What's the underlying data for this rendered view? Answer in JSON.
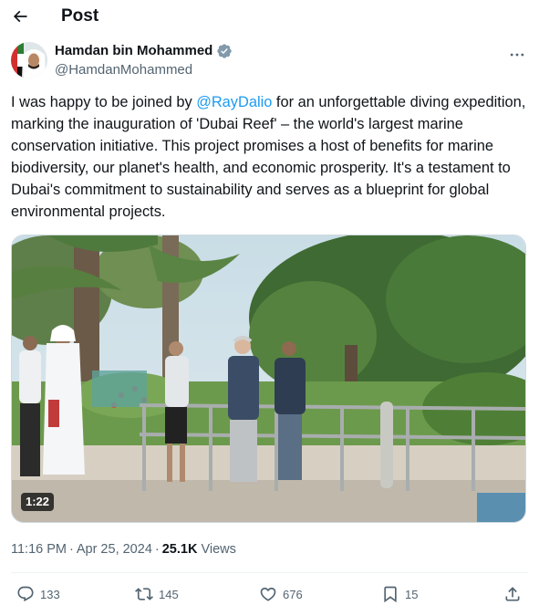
{
  "header": {
    "title": "Post",
    "back_icon": "arrow-left-icon"
  },
  "author": {
    "display_name": "Hamdan bin Mohammed",
    "handle": "@HamdanMohammed",
    "verified_icon": "verified-badge-icon",
    "verified_color": "#829aab",
    "more_icon": "more-horizontal-icon"
  },
  "tweet": {
    "text_before_mention": "I was happy to be joined by ",
    "mention": "@RayDalio",
    "text_after_mention": " for an unforgettable diving expedition, marking the inauguration of 'Dubai Reef' – the world's largest marine conservation initiative. This project promises a host of benefits for marine biodiversity, our planet's health, and economic prosperity. It's a testament to Dubai's commitment to sustainability and serves as a blueprint for global environmental projects.",
    "mention_color": "#1d9bf0"
  },
  "media": {
    "type": "video",
    "duration": "1:22"
  },
  "meta": {
    "time": "11:16 PM",
    "separator": "·",
    "date": "Apr 25, 2024",
    "views_count": "25.1K",
    "views_label": "Views"
  },
  "actions": {
    "replies": {
      "icon": "reply-icon",
      "count": "133"
    },
    "reposts": {
      "icon": "repost-icon",
      "count": "145"
    },
    "likes": {
      "icon": "heart-icon",
      "count": "676"
    },
    "bookmarks": {
      "icon": "bookmark-icon",
      "count": "15"
    },
    "share": {
      "icon": "share-icon"
    }
  },
  "colors": {
    "text": "#0f1419",
    "secondary": "#536471",
    "accent": "#1d9bf0"
  }
}
